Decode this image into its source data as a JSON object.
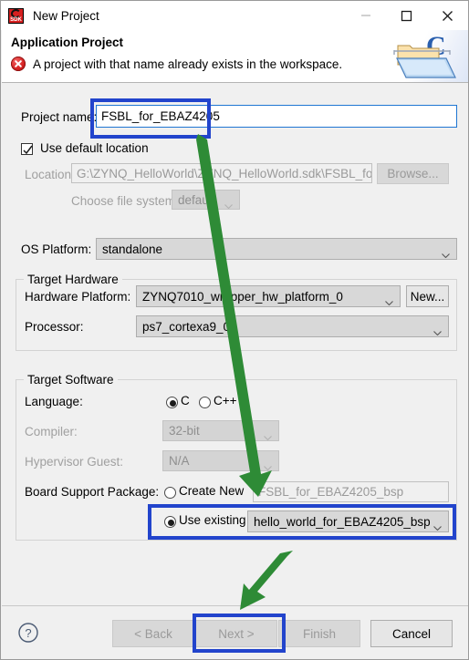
{
  "window": {
    "title": "New Project",
    "app_icon": "sdk-icon",
    "minimize_label": "—",
    "maximize_label": "□",
    "close_label": "✕"
  },
  "banner": {
    "title": "Application Project",
    "message": "A project with that name already exists in the workspace.",
    "error_icon": "error-circle-icon",
    "art_icon": "c-folder-icon"
  },
  "form": {
    "project_name_label": "Project name:",
    "project_name_value": "FSBL_for_EBAZ4205",
    "use_default_location_label": "Use default location",
    "use_default_location_checked": true,
    "location_label": "Location:",
    "location_value": "G:\\ZYNQ_HelloWorld\\ZYNQ_HelloWorld.sdk\\FSBL_for_E",
    "browse_label": "Browse...",
    "choose_file_system_label": "Choose file system:",
    "choose_file_system_value": "default",
    "os_platform_label": "OS Platform:",
    "os_platform_value": "standalone"
  },
  "target_hardware": {
    "legend": "Target Hardware",
    "hardware_platform_label": "Hardware Platform:",
    "hardware_platform_value": "ZYNQ7010_wrapper_hw_platform_0",
    "new_button_label": "New...",
    "processor_label": "Processor:",
    "processor_value": "ps7_cortexa9_0"
  },
  "target_software": {
    "legend": "Target Software",
    "language_label": "Language:",
    "language_option_c": "C",
    "language_option_cpp": "C++",
    "language_selected": "C",
    "compiler_label": "Compiler:",
    "compiler_value": "32-bit",
    "hypervisor_label": "Hypervisor Guest:",
    "hypervisor_value": "N/A",
    "bsp_label": "Board Support Package:",
    "bsp_create_new_label": "Create New",
    "bsp_create_new_value": "FSBL_for_EBAZ4205_bsp",
    "bsp_use_existing_label": "Use existing",
    "bsp_use_existing_value": "hello_world_for_EBAZ4205_bsp",
    "bsp_selected": "Use existing"
  },
  "footer": {
    "help_icon": "help-question-icon",
    "back_label": "< Back",
    "next_label": "Next >",
    "finish_label": "Finish",
    "cancel_label": "Cancel"
  },
  "annotations": {
    "highlight_color": "#2244cc",
    "arrow_color": "#2e8b36",
    "highlighted_items": [
      "project-name-field",
      "bsp-use-existing-row",
      "next-button"
    ]
  }
}
